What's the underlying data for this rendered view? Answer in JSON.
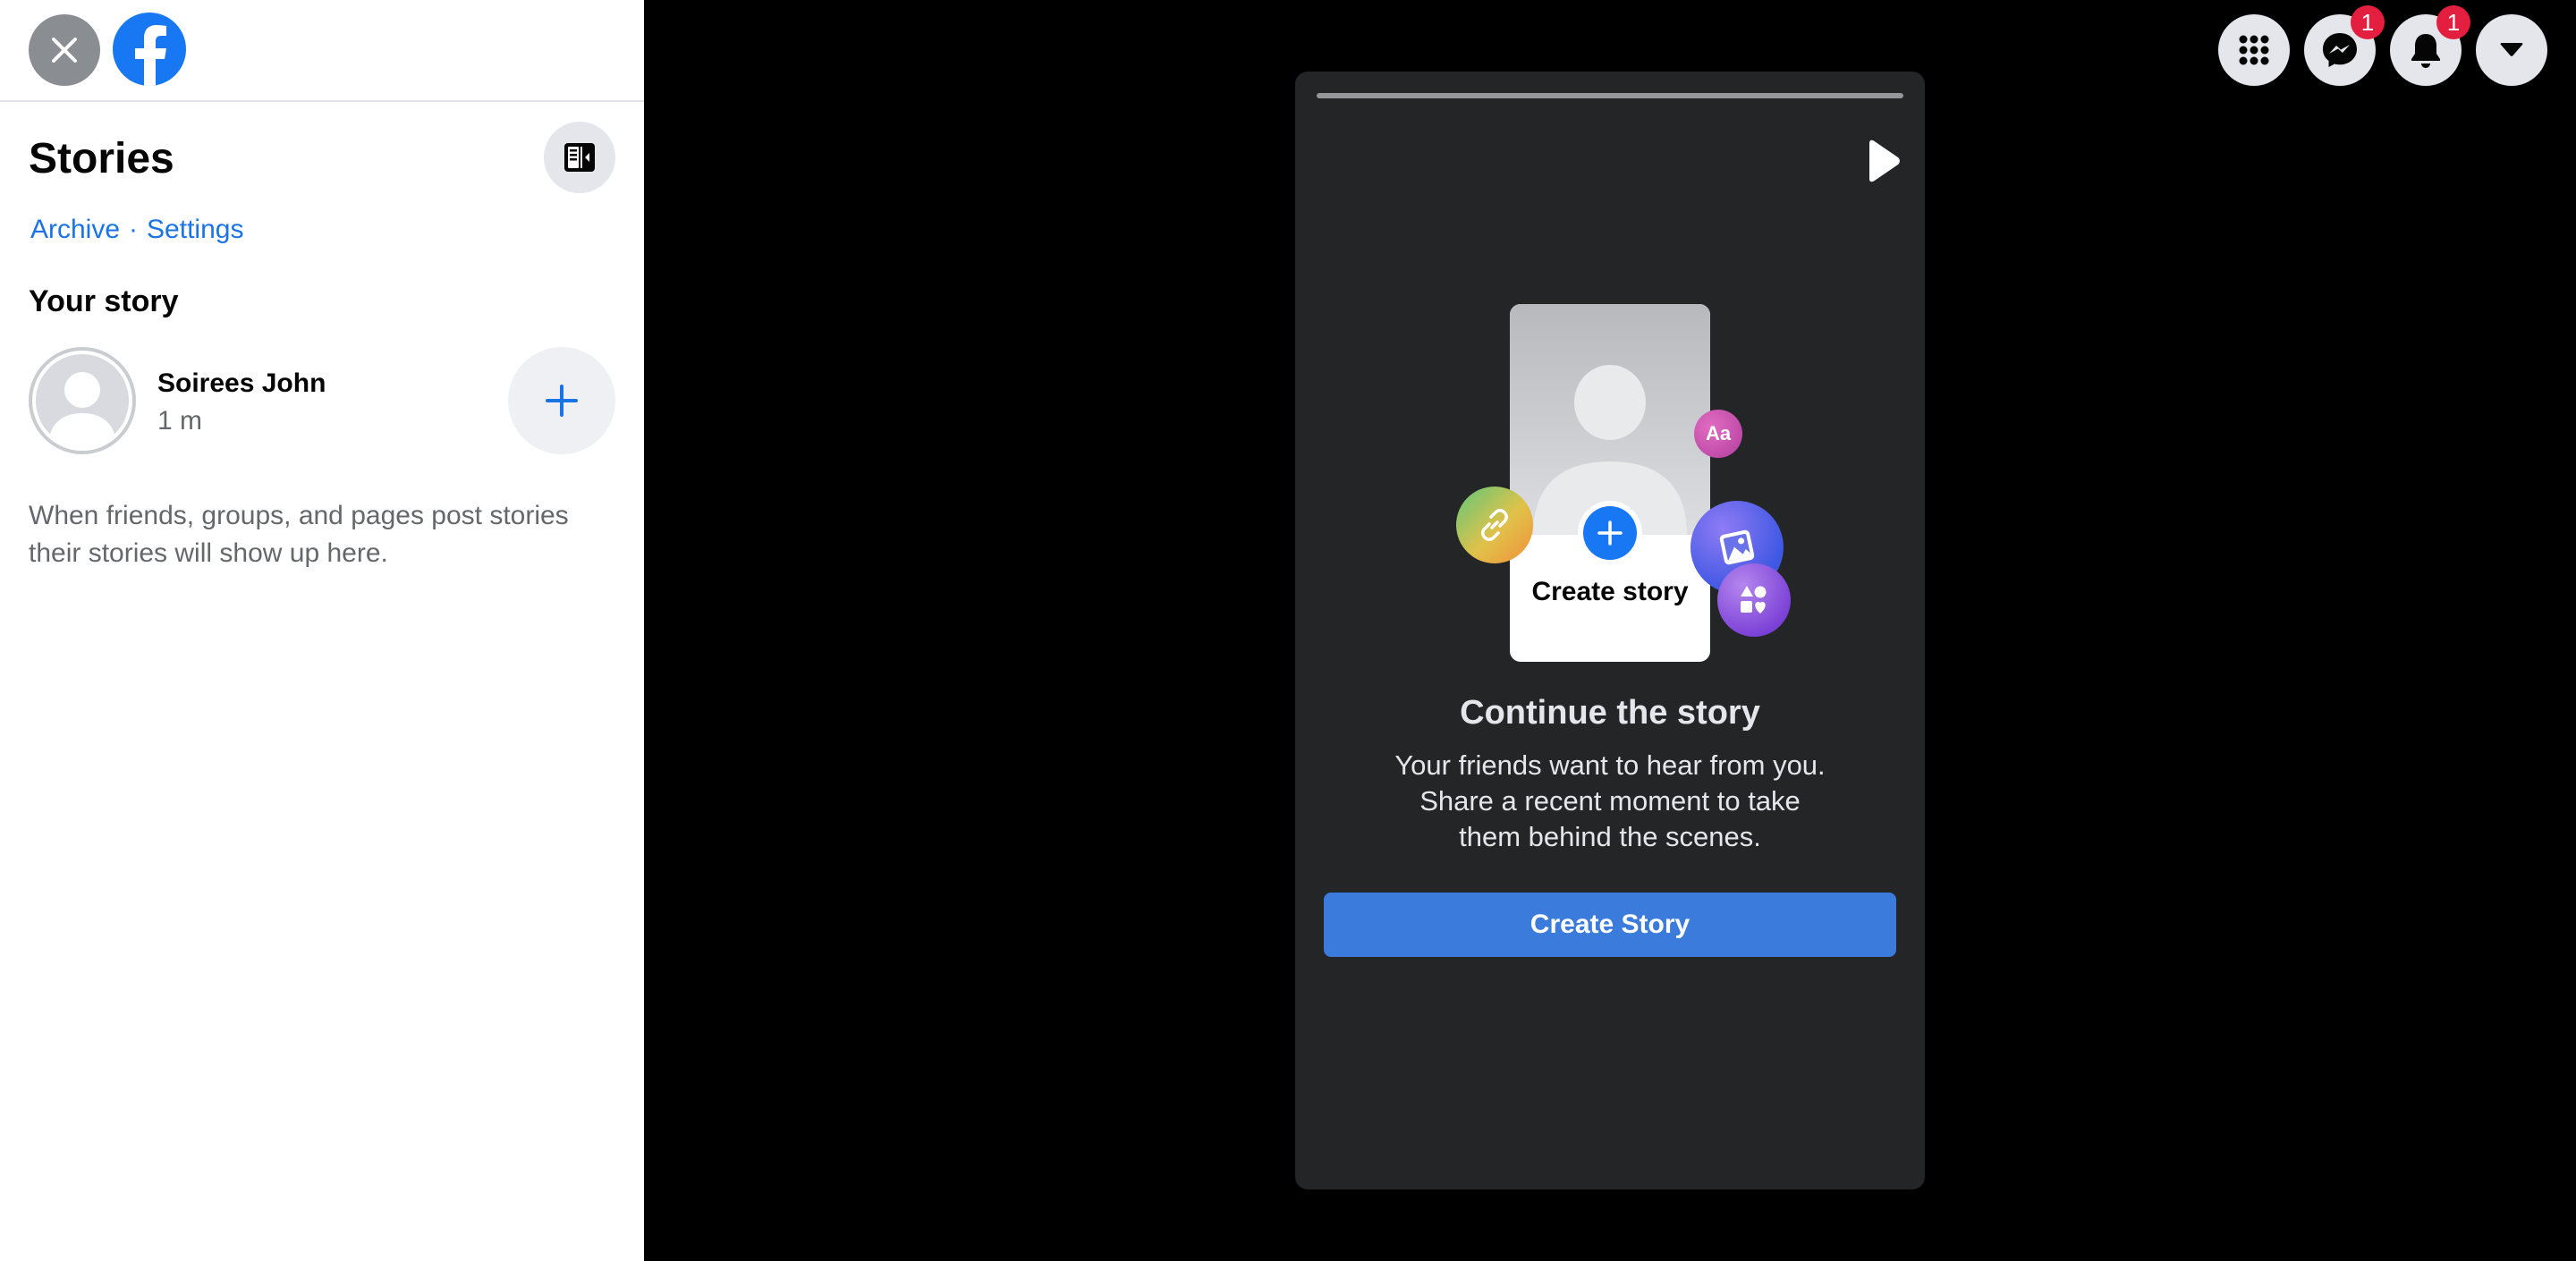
{
  "sidebar": {
    "title": "Stories",
    "archive_link": "Archive",
    "link_separator": "·",
    "settings_link": "Settings",
    "your_story_heading": "Your story",
    "story": {
      "name": "Soirees John",
      "time": "1 m"
    },
    "empty_message": "When friends, groups, and pages post stories their stories will show up here."
  },
  "header": {
    "messenger_badge": "1",
    "notifications_badge": "1"
  },
  "story_card": {
    "illustration_label": "Create story",
    "text_bubble_label": "Aa",
    "title": "Continue the story",
    "description": "Your friends want to hear from you. Share a recent moment to take them behind the scenes.",
    "button_label": "Create Story"
  },
  "colors": {
    "accent": "#1877f2",
    "button": "#3a7bdc",
    "card_bg": "#242526",
    "badge": "#e41e3f"
  },
  "icons": [
    "close-icon",
    "facebook-logo",
    "panel-toggle-icon",
    "plus-icon",
    "menu-grid-icon",
    "messenger-icon",
    "bell-icon",
    "caret-down-icon",
    "play-icon",
    "link-icon",
    "photo-icon",
    "shapes-icon"
  ]
}
